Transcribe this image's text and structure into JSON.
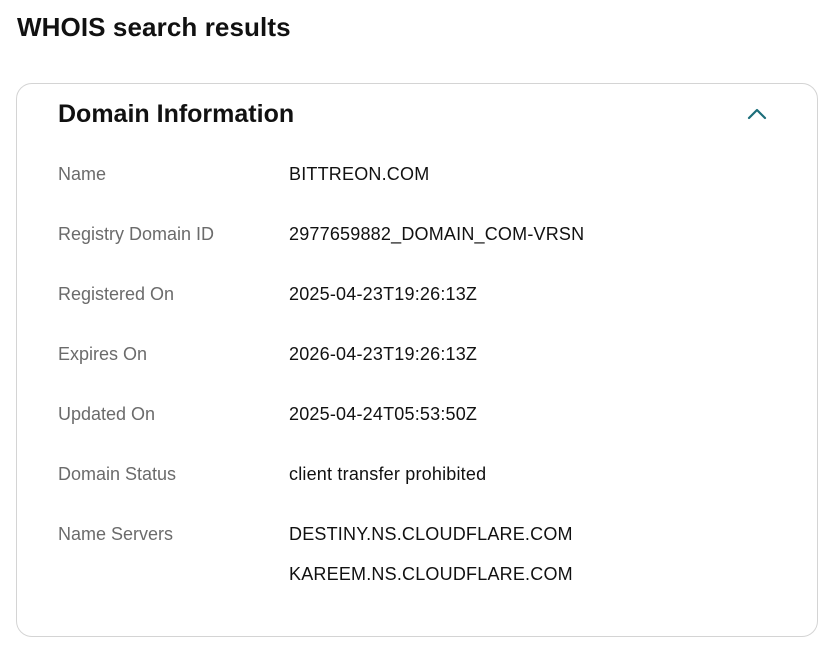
{
  "page": {
    "title": "WHOIS search results"
  },
  "domain_info": {
    "title": "Domain Information",
    "toggle_icon": "chevron-up-icon",
    "accent_color": "#1c6e7a",
    "rows": [
      {
        "label": "Name",
        "value": "BITTREON.COM"
      },
      {
        "label": "Registry Domain ID",
        "value": "2977659882_DOMAIN_COM-VRSN"
      },
      {
        "label": "Registered On",
        "value": "2025-04-23T19:26:13Z"
      },
      {
        "label": "Expires On",
        "value": "2026-04-23T19:26:13Z"
      },
      {
        "label": "Updated On",
        "value": "2025-04-24T05:53:50Z"
      },
      {
        "label": "Domain Status",
        "value": "client transfer prohibited"
      }
    ],
    "name_servers": {
      "label": "Name Servers",
      "values": [
        "DESTINY.NS.CLOUDFLARE.COM",
        "KAREEM.NS.CLOUDFLARE.COM"
      ]
    }
  }
}
